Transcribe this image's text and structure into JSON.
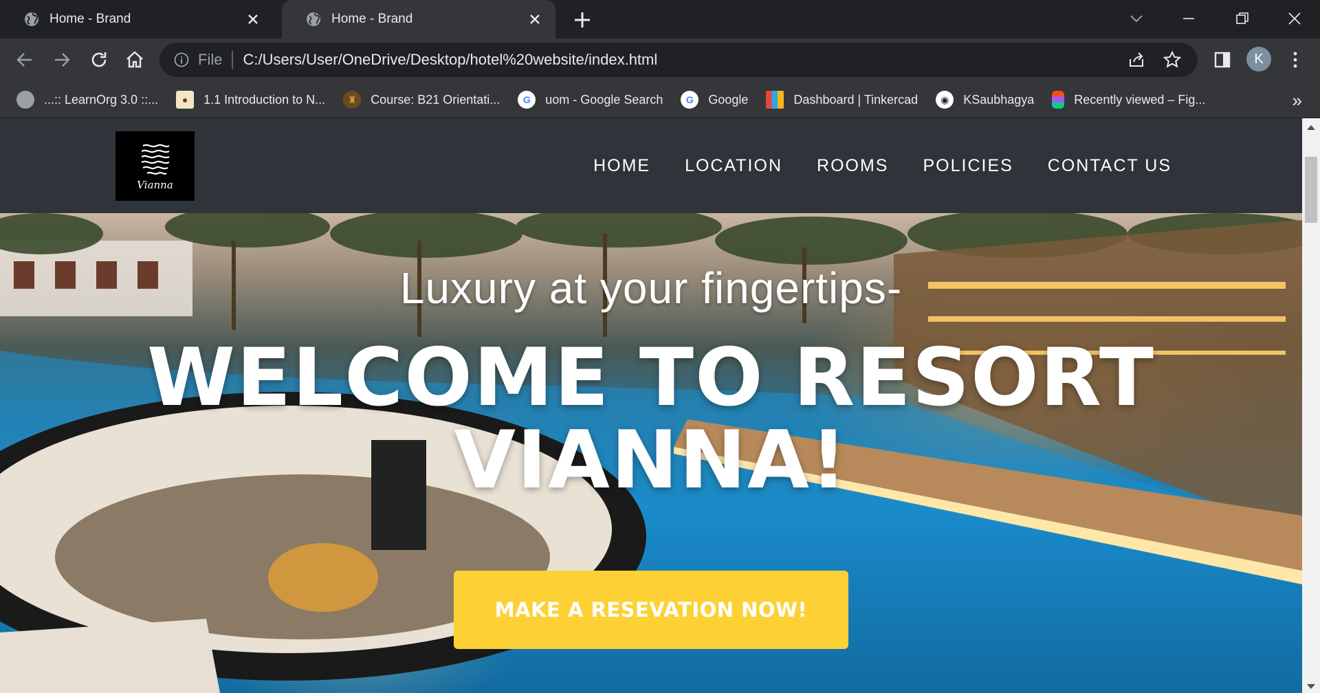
{
  "browser": {
    "tabs": [
      {
        "title": "Home - Brand",
        "active": false
      },
      {
        "title": "Home - Brand",
        "active": true
      }
    ],
    "address": {
      "scheme": "File",
      "url": "C:/Users/User/OneDrive/Desktop/hotel%20website/index.html"
    },
    "profile_initial": "K",
    "bookmarks": [
      {
        "label": "...:: LearnOrg 3.0 ::...",
        "icon": "globe-icon"
      },
      {
        "label": "1.1 Introduction to N...",
        "icon": "uom-crest-icon"
      },
      {
        "label": "Course: B21 Orientati...",
        "icon": "moodle-icon"
      },
      {
        "label": "uom - Google Search",
        "icon": "google-icon"
      },
      {
        "label": "Google",
        "icon": "google-icon"
      },
      {
        "label": "Dashboard | Tinkercad",
        "icon": "tinkercad-icon"
      },
      {
        "label": "KSaubhagya",
        "icon": "github-icon"
      },
      {
        "label": "Recently viewed – Fig...",
        "icon": "figma-icon"
      }
    ],
    "more_bookmarks": "»"
  },
  "site": {
    "logo_text": "Vianna",
    "nav": [
      "HOME",
      "LOCATION",
      "ROOMS",
      "POLICIES",
      "CONTACT US"
    ],
    "hero": {
      "tagline": "Luxury at your fingertips-",
      "headline_line1": "WELCOME TO RESORT",
      "headline_line2": "VIANNA!",
      "cta": "MAKE A RESEVATION NOW!"
    }
  },
  "colors": {
    "cta": "#fdd135",
    "header": "#2f343a",
    "chrome": "#35363a"
  }
}
